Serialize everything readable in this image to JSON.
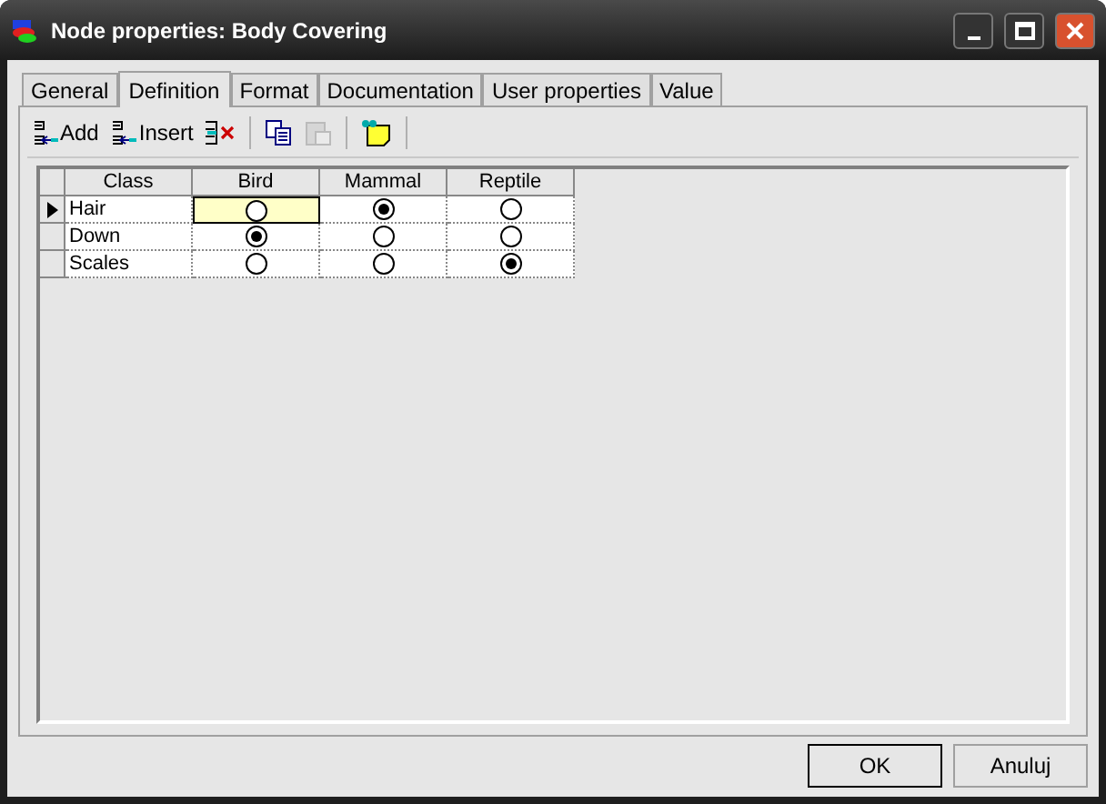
{
  "window": {
    "title": "Node properties: Body Covering"
  },
  "tabs": [
    {
      "label": "General",
      "selected": false
    },
    {
      "label": "Definition",
      "selected": true
    },
    {
      "label": "Format",
      "selected": false
    },
    {
      "label": "Documentation",
      "selected": false
    },
    {
      "label": "User properties",
      "selected": false
    },
    {
      "label": "Value",
      "selected": false
    }
  ],
  "toolbar": [
    {
      "kind": "add",
      "label": "Add",
      "disabled": false
    },
    {
      "kind": "insert",
      "label": "Insert",
      "disabled": false
    },
    {
      "kind": "delete",
      "disabled": false
    },
    {
      "kind": "copy",
      "disabled": false
    },
    {
      "kind": "paste",
      "disabled": true
    },
    {
      "kind": "note",
      "disabled": false
    }
  ],
  "table": {
    "columns": [
      "Class",
      "Bird",
      "Mammal",
      "Reptile"
    ],
    "rows": [
      {
        "class": "Hair",
        "current": true,
        "options": [
          {
            "selected": false,
            "focused": true
          },
          {
            "selected": true,
            "focused": false
          },
          {
            "selected": false,
            "focused": false
          }
        ]
      },
      {
        "class": "Down",
        "current": false,
        "options": [
          {
            "selected": true,
            "focused": false
          },
          {
            "selected": false,
            "focused": false
          },
          {
            "selected": false,
            "focused": false
          }
        ]
      },
      {
        "class": "Scales",
        "current": false,
        "options": [
          {
            "selected": false,
            "focused": false
          },
          {
            "selected": false,
            "focused": false
          },
          {
            "selected": true,
            "focused": false
          }
        ]
      }
    ]
  },
  "buttons": [
    "OK",
    "Anuluj"
  ]
}
